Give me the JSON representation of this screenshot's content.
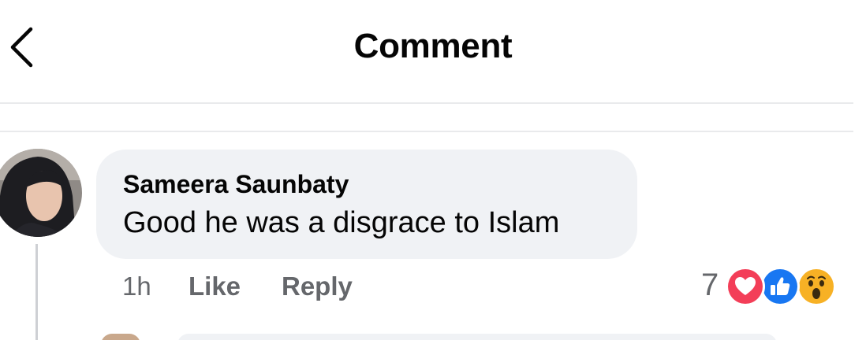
{
  "header": {
    "back_icon": "chevron-left-icon",
    "title": "Comment"
  },
  "comment": {
    "author": "Sameera Saunbaty",
    "text": "Good he was a disgrace to Islam",
    "time": "1h",
    "like_label": "Like",
    "reply_label": "Reply",
    "reaction_count": "7",
    "reactions": [
      "love",
      "like",
      "wow"
    ]
  },
  "colors": {
    "bubble": "#f0f2f5",
    "text_primary": "#050505",
    "text_secondary": "#65676b",
    "love": "#f33e58",
    "like": "#1877f2",
    "wow": "#f7b125"
  }
}
